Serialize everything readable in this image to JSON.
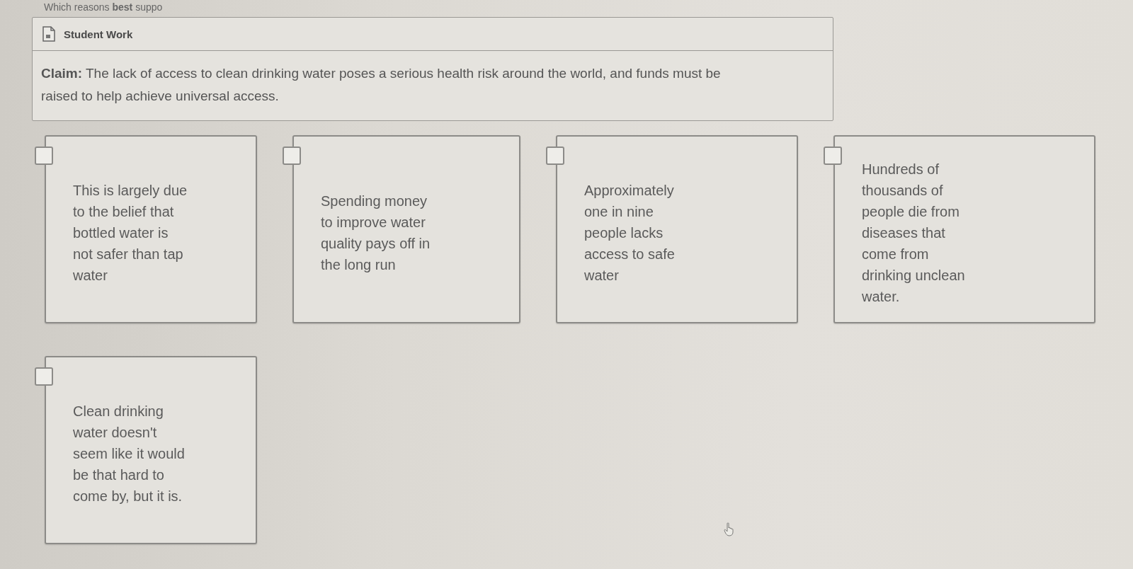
{
  "question": "Which reasons **best** suppo",
  "student_work": {
    "title": "Student Work",
    "claim": "**Claim:** The lack of access to clean drinking water poses a serious health risk around the world, and funds must be raised to help achieve universal access."
  },
  "cards": [
    {
      "text": "This is largely due to the belief that bottled water is not safer than tap water",
      "checked": false
    },
    {
      "text": "Spending money to improve water quality pays off in the long run",
      "checked": false
    },
    {
      "text": "Approximately one in nine people lacks access to safe water",
      "checked": false
    },
    {
      "text": "Hundreds of thousands of people die from diseases that come from drinking unclean water.",
      "checked": false
    },
    {
      "text": "Clean drinking water doesn't seem like it would be that hard to come by, but it is.",
      "checked": false
    }
  ]
}
